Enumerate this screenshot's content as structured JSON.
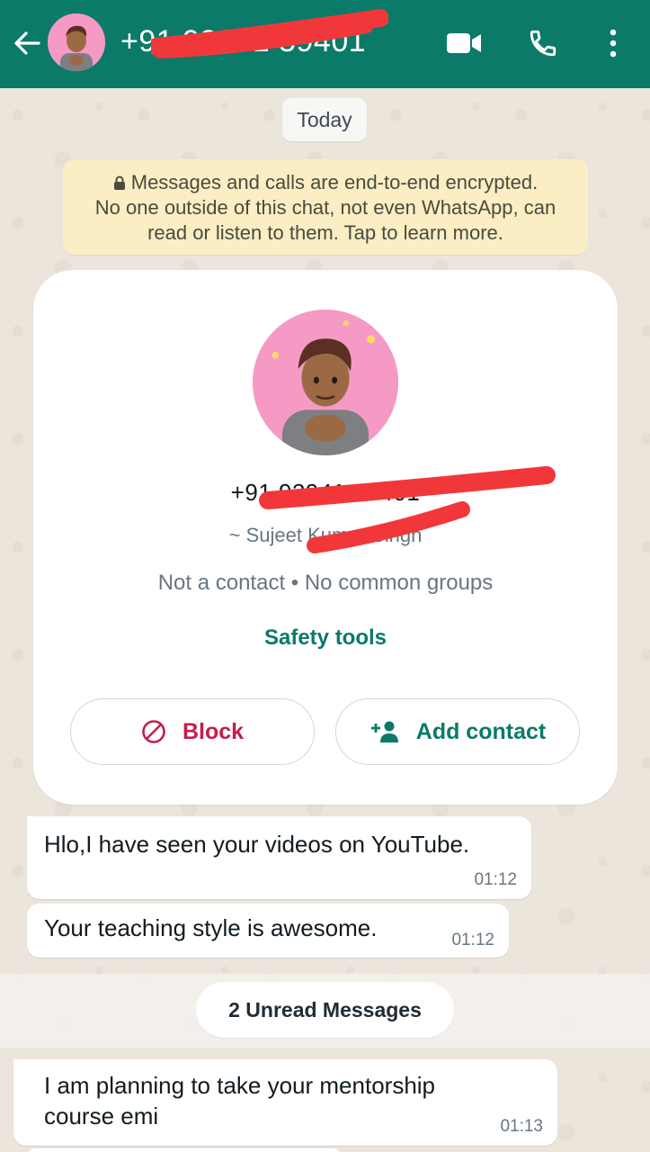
{
  "header": {
    "back_icon": "arrow-left-icon",
    "contact_number": "+91 93941 59401",
    "video_icon": "video-call-icon",
    "call_icon": "phone-icon",
    "menu_icon": "more-vertical-icon",
    "background_color": "#0b7a68"
  },
  "chat": {
    "date_chip": "Today",
    "encryption_notice": {
      "line1": "Messages and calls are end-to-end encrypted.",
      "line2": "No one outside of this chat, not even WhatsApp, can",
      "line3": "read or listen to them. Tap to learn more."
    },
    "profile_card": {
      "number": "+91 93941 59401",
      "alias": "~ Sujeet Kumar Singh",
      "meta": "Not a contact • No common groups",
      "safety_tools": "Safety tools",
      "block_label": "Block",
      "add_contact_label": "Add contact"
    },
    "messages": [
      {
        "text": "Hlo,I have seen your videos on YouTube.",
        "time": "01:12"
      },
      {
        "text": "Your teaching style is awesome.",
        "time": "01:12"
      },
      {
        "text": "I am planning to take your mentorship course emi",
        "time": "01:13"
      }
    ],
    "unread_divider": "2 Unread Messages"
  },
  "colors": {
    "accent": "#0b7a68",
    "danger": "#c41e4b",
    "redaction": "#f2373a"
  }
}
